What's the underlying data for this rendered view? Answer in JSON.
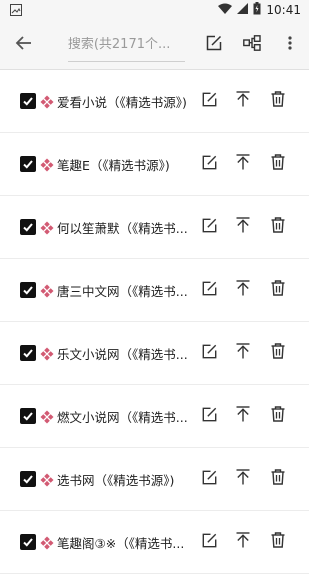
{
  "status_bar": {
    "time": "10:41",
    "battery_level": "0.8"
  },
  "toolbar": {
    "search_placeholder": "搜索(共2171个..."
  },
  "sources": [
    {
      "name": "爱看小说（《精选书源》)",
      "checked": true
    },
    {
      "name": "笔趣E（《精选书源》)",
      "checked": true
    },
    {
      "name": "何以笙萧默（《精选书...",
      "checked": true
    },
    {
      "name": "唐三中文网（《精选书...",
      "checked": true
    },
    {
      "name": "乐文小说网（《精选书...",
      "checked": true
    },
    {
      "name": "燃文小说网（《精选书...",
      "checked": true
    },
    {
      "name": "选书网（《精选书源》)",
      "checked": true
    },
    {
      "name": "笔趣阁③※（《精选书...",
      "checked": true
    }
  ],
  "colors": {
    "diamond": "#d25a73",
    "checkbox": "#111111",
    "icon": "#333333"
  }
}
